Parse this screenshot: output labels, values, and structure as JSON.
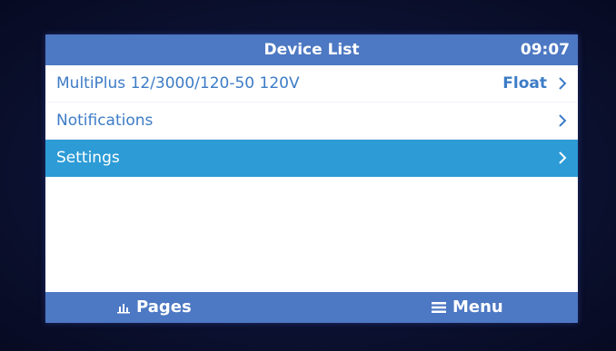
{
  "header": {
    "title": "Device List",
    "time": "09:07"
  },
  "list": {
    "items": [
      {
        "label": "MultiPlus 12/3000/120-50 120V",
        "value": "Float",
        "selected": false
      },
      {
        "label": "Notifications",
        "value": "",
        "selected": false
      },
      {
        "label": "Settings",
        "value": "",
        "selected": true
      }
    ]
  },
  "footer": {
    "pages_label": "Pages",
    "menu_label": "Menu"
  },
  "colors": {
    "bar": "#4d78c3",
    "selected_row": "#2c9bd6",
    "row_text": "#3d7cc6",
    "background": "#0b1130"
  }
}
